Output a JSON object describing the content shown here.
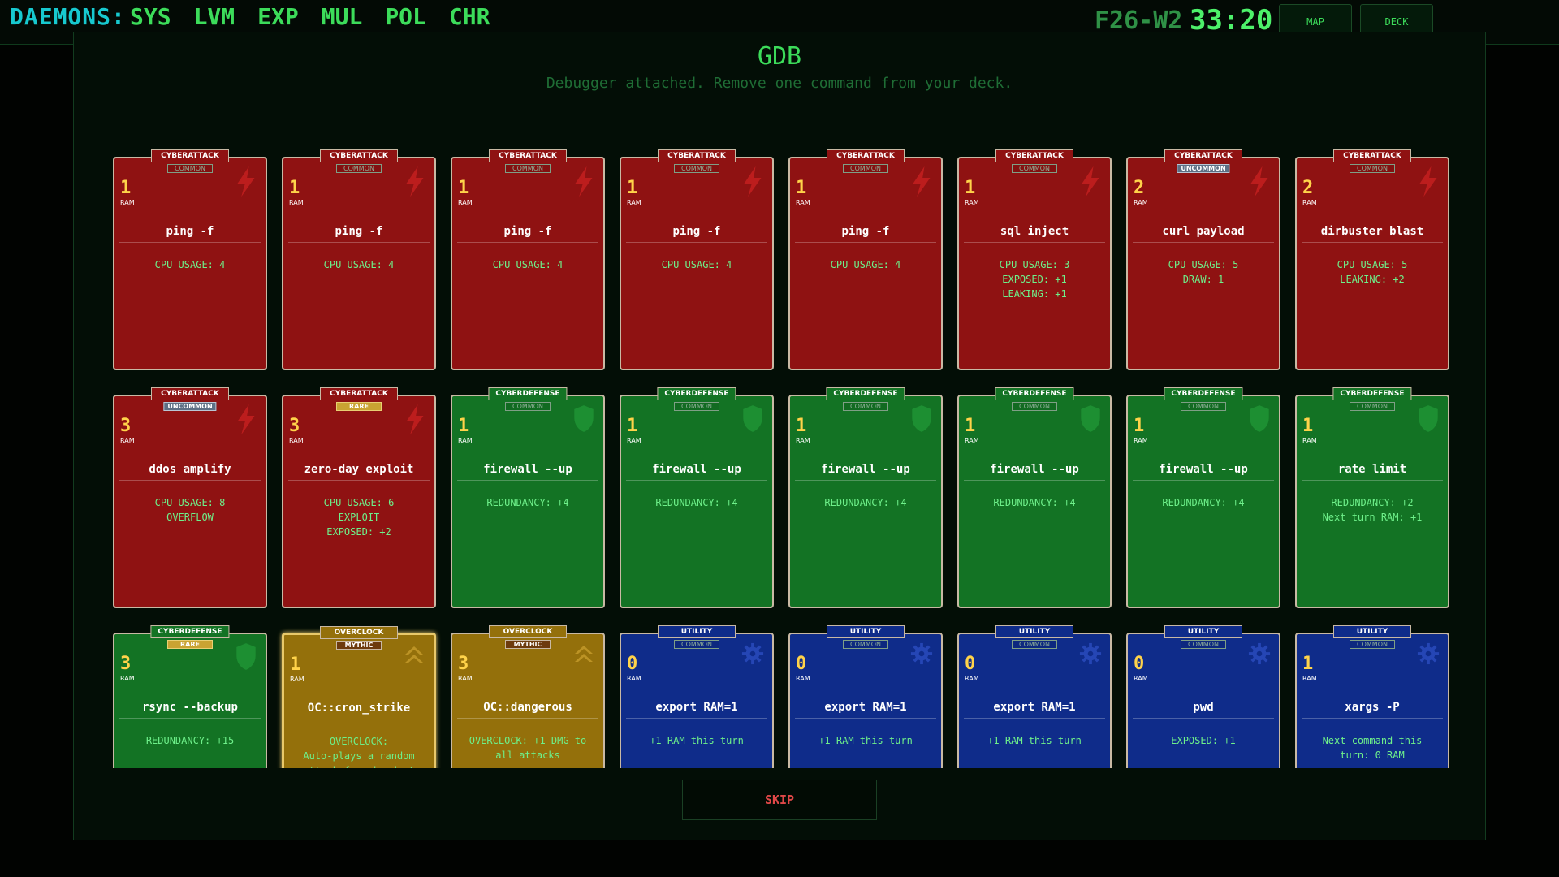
{
  "brand": "DAEMONS:",
  "nav": [
    "SYS",
    "LVM",
    "EXP",
    "MUL",
    "POL",
    "CHR"
  ],
  "floor": "F26-W2",
  "timer": "33:20",
  "buttons": {
    "map": "MAP",
    "deck": "DECK",
    "skip": "SKIP"
  },
  "title": "GDB",
  "subtitle": "Debugger attached. Remove one command from your deck.",
  "ram_label": "RAM",
  "cards": [
    {
      "kind": "attack",
      "type": "CYBERATTACK",
      "rarity": "COMMON",
      "cost": "1",
      "name": "ping -f",
      "effect": [
        "CPU USAGE: 4"
      ],
      "icon": "lightning-icon"
    },
    {
      "kind": "attack",
      "type": "CYBERATTACK",
      "rarity": "COMMON",
      "cost": "1",
      "name": "ping -f",
      "effect": [
        "CPU USAGE: 4"
      ],
      "icon": "lightning-icon"
    },
    {
      "kind": "attack",
      "type": "CYBERATTACK",
      "rarity": "COMMON",
      "cost": "1",
      "name": "ping -f",
      "effect": [
        "CPU USAGE: 4"
      ],
      "icon": "lightning-icon"
    },
    {
      "kind": "attack",
      "type": "CYBERATTACK",
      "rarity": "COMMON",
      "cost": "1",
      "name": "ping -f",
      "effect": [
        "CPU USAGE: 4"
      ],
      "icon": "lightning-icon"
    },
    {
      "kind": "attack",
      "type": "CYBERATTACK",
      "rarity": "COMMON",
      "cost": "1",
      "name": "ping -f",
      "effect": [
        "CPU USAGE: 4"
      ],
      "icon": "lightning-icon"
    },
    {
      "kind": "attack",
      "type": "CYBERATTACK",
      "rarity": "COMMON",
      "cost": "1",
      "name": "sql inject",
      "effect": [
        "CPU USAGE: 3",
        "EXPOSED: +1",
        "LEAKING: +1"
      ],
      "icon": "lightning-icon"
    },
    {
      "kind": "attack",
      "type": "CYBERATTACK",
      "rarity": "UNCOMMON",
      "cost": "2",
      "name": "curl payload",
      "effect": [
        "CPU USAGE: 5",
        "DRAW: 1"
      ],
      "icon": "lightning-icon"
    },
    {
      "kind": "attack",
      "type": "CYBERATTACK",
      "rarity": "COMMON",
      "cost": "2",
      "name": "dirbuster blast",
      "effect": [
        "CPU USAGE: 5",
        "LEAKING: +2"
      ],
      "icon": "lightning-icon"
    },
    {
      "kind": "attack",
      "type": "CYBERATTACK",
      "rarity": "UNCOMMON",
      "cost": "3",
      "name": "ddos amplify",
      "effect": [
        "CPU USAGE: 8",
        "OVERFLOW"
      ],
      "icon": "lightning-icon"
    },
    {
      "kind": "attack",
      "type": "CYBERATTACK",
      "rarity": "RARE",
      "cost": "3",
      "name": "zero-day exploit",
      "effect": [
        "CPU USAGE: 6",
        "EXPLOIT",
        "EXPOSED: +2"
      ],
      "icon": "lightning-icon"
    },
    {
      "kind": "defense",
      "type": "CYBERDEFENSE",
      "rarity": "COMMON",
      "cost": "1",
      "name": "firewall --up",
      "effect": [
        "REDUNDANCY: +4"
      ],
      "icon": "shield-icon"
    },
    {
      "kind": "defense",
      "type": "CYBERDEFENSE",
      "rarity": "COMMON",
      "cost": "1",
      "name": "firewall --up",
      "effect": [
        "REDUNDANCY: +4"
      ],
      "icon": "shield-icon"
    },
    {
      "kind": "defense",
      "type": "CYBERDEFENSE",
      "rarity": "COMMON",
      "cost": "1",
      "name": "firewall --up",
      "effect": [
        "REDUNDANCY: +4"
      ],
      "icon": "shield-icon"
    },
    {
      "kind": "defense",
      "type": "CYBERDEFENSE",
      "rarity": "COMMON",
      "cost": "1",
      "name": "firewall --up",
      "effect": [
        "REDUNDANCY: +4"
      ],
      "icon": "shield-icon"
    },
    {
      "kind": "defense",
      "type": "CYBERDEFENSE",
      "rarity": "COMMON",
      "cost": "1",
      "name": "firewall --up",
      "effect": [
        "REDUNDANCY: +4"
      ],
      "icon": "shield-icon"
    },
    {
      "kind": "defense",
      "type": "CYBERDEFENSE",
      "rarity": "COMMON",
      "cost": "1",
      "name": "rate limit",
      "effect": [
        "REDUNDANCY: +2",
        "Next turn RAM: +1"
      ],
      "icon": "shield-icon"
    },
    {
      "kind": "defense",
      "type": "CYBERDEFENSE",
      "rarity": "RARE",
      "cost": "3",
      "name": "rsync --backup",
      "effect": [
        "REDUNDANCY: +15"
      ],
      "icon": "shield-icon"
    },
    {
      "kind": "overclock",
      "type": "OVERCLOCK",
      "rarity": "MYTHIC",
      "cost": "1",
      "name": "OC::cron_strike",
      "effect": [
        "OVERCLOCK:",
        "Auto-plays a random",
        "attack from hand at"
      ],
      "icon": "chevron-up-icon",
      "selected": true
    },
    {
      "kind": "overclock",
      "type": "OVERCLOCK",
      "rarity": "MYTHIC",
      "cost": "3",
      "name": "OC::dangerous",
      "effect": [
        "OVERCLOCK: +1 DMG to",
        "all attacks"
      ],
      "icon": "chevron-up-icon"
    },
    {
      "kind": "utility",
      "type": "UTILITY",
      "rarity": "COMMON",
      "cost": "0",
      "name": "export RAM=1",
      "effect": [
        "+1 RAM this turn"
      ],
      "icon": "gear-icon"
    },
    {
      "kind": "utility",
      "type": "UTILITY",
      "rarity": "COMMON",
      "cost": "0",
      "name": "export RAM=1",
      "effect": [
        "+1 RAM this turn"
      ],
      "icon": "gear-icon"
    },
    {
      "kind": "utility",
      "type": "UTILITY",
      "rarity": "COMMON",
      "cost": "0",
      "name": "export RAM=1",
      "effect": [
        "+1 RAM this turn"
      ],
      "icon": "gear-icon"
    },
    {
      "kind": "utility",
      "type": "UTILITY",
      "rarity": "COMMON",
      "cost": "0",
      "name": "pwd",
      "effect": [
        "EXPOSED: +1"
      ],
      "icon": "gear-icon"
    },
    {
      "kind": "utility",
      "type": "UTILITY",
      "rarity": "COMMON",
      "cost": "1",
      "name": "xargs -P",
      "effect": [
        "Next command this",
        "turn: 0 RAM"
      ],
      "icon": "gear-icon"
    }
  ],
  "colors": {
    "attack": "#8f1212",
    "defense": "#137324",
    "overclock": "#94700b",
    "utility": "#0f2c8a",
    "cost": "#ffd34a",
    "effect": "#6ef08a"
  }
}
